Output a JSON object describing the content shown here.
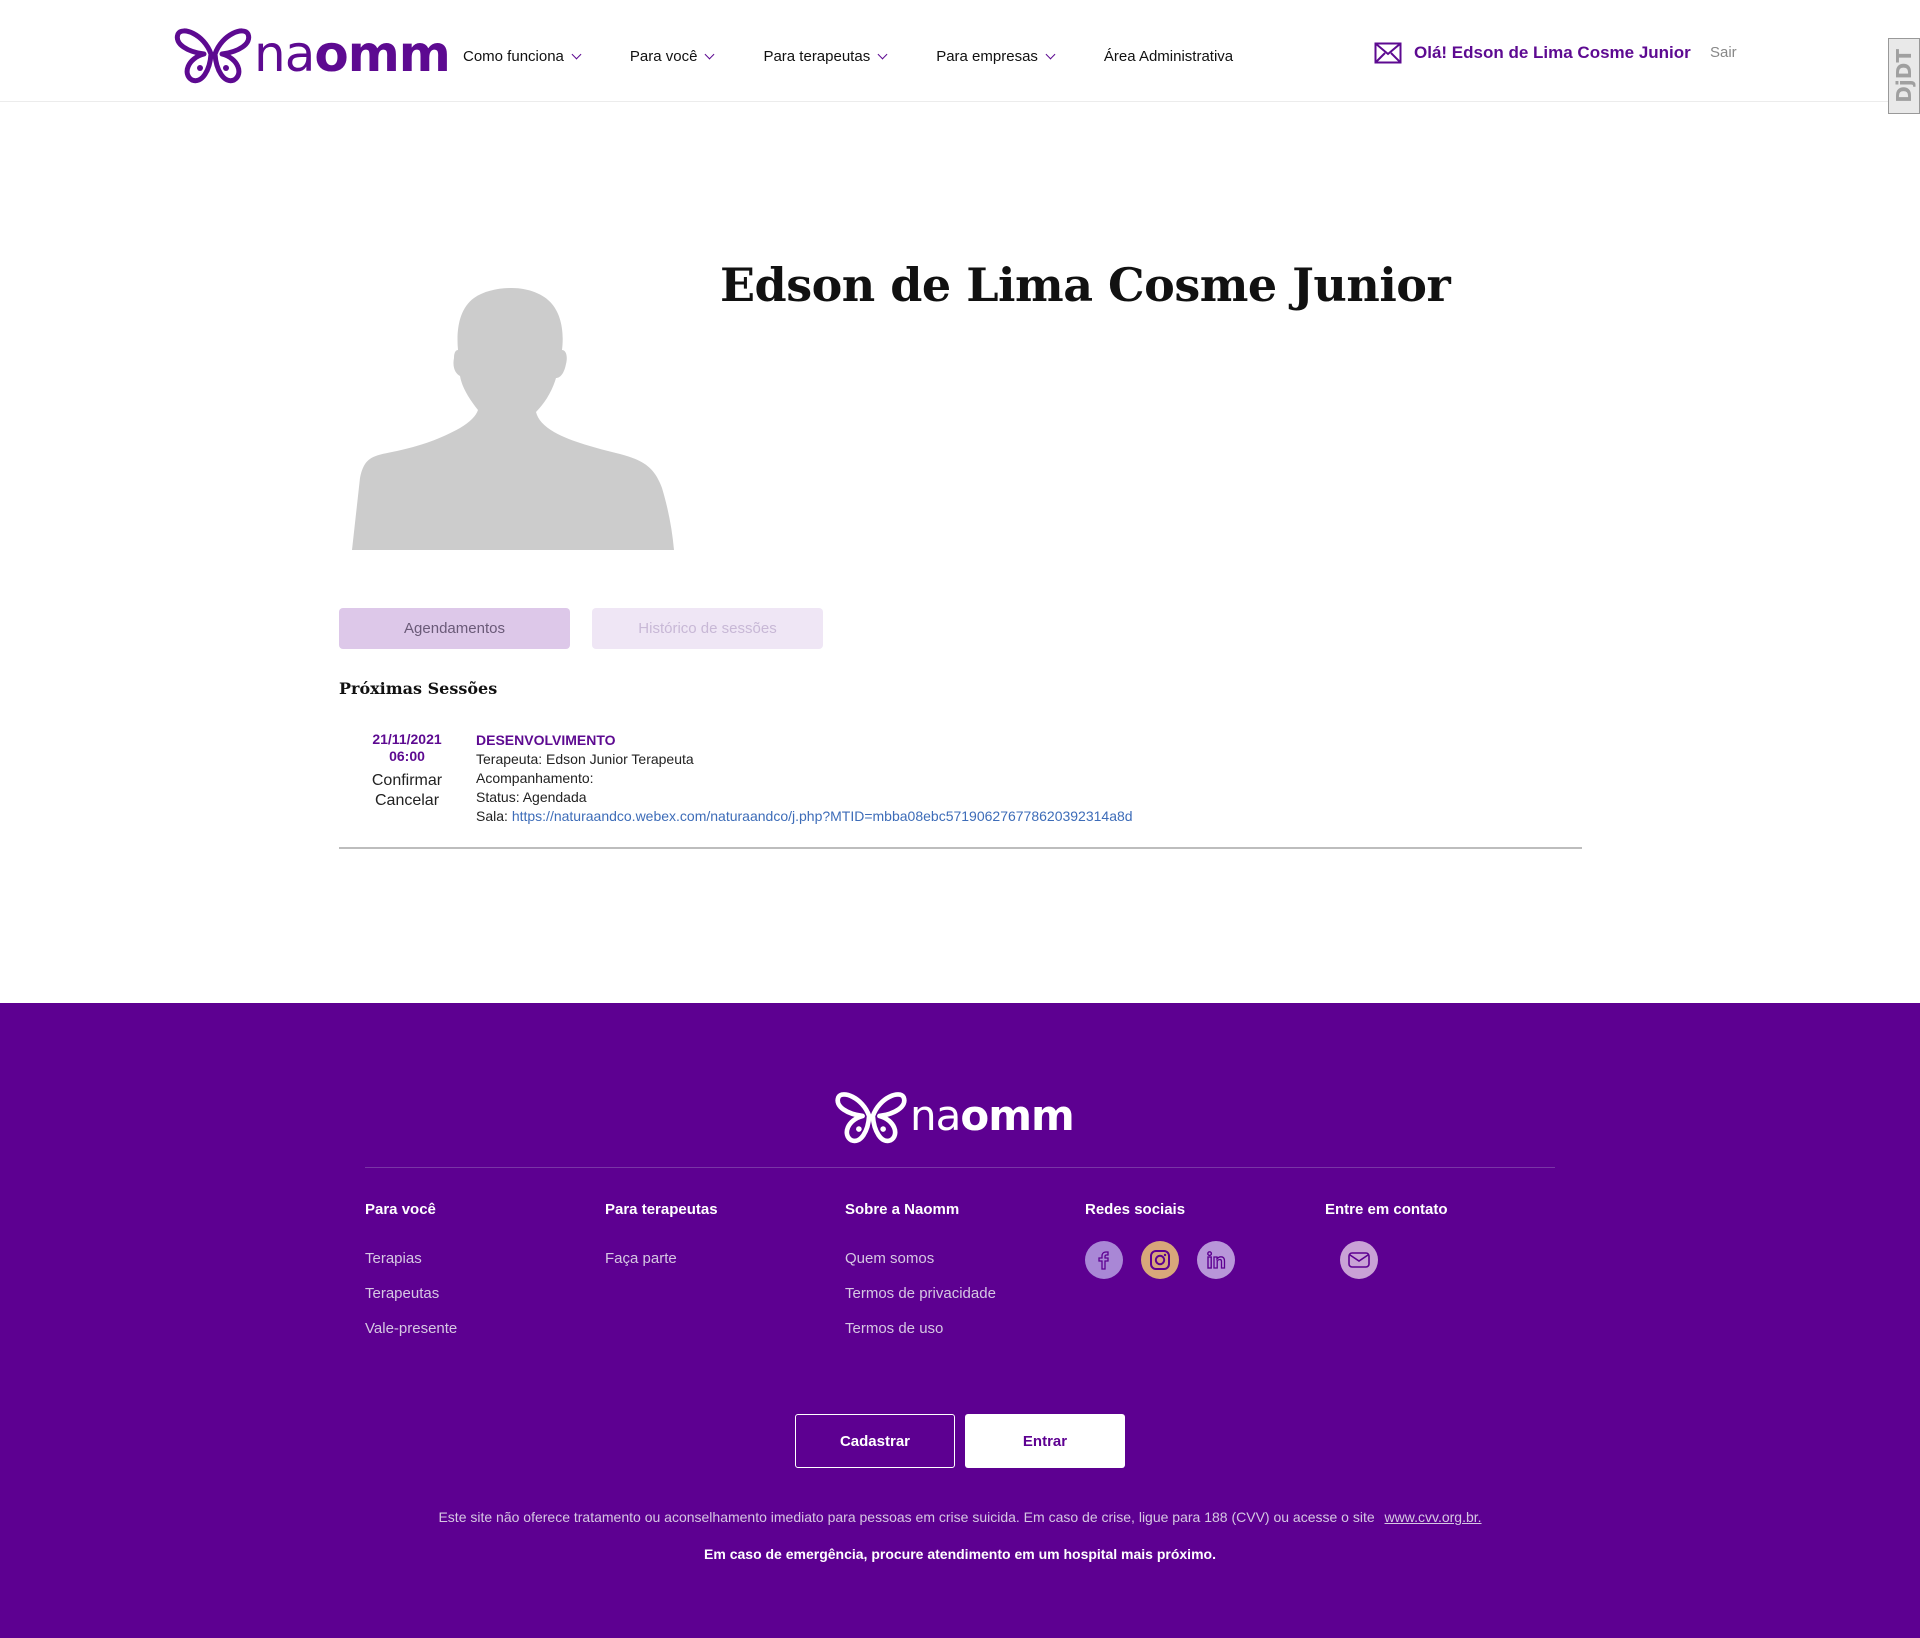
{
  "brand": {
    "logo_text_light": "na",
    "logo_text_bold": "omm",
    "color": "#5d0a91"
  },
  "nav": {
    "items": [
      {
        "label": "Como funciona",
        "has_dropdown": true
      },
      {
        "label": "Para você",
        "has_dropdown": true
      },
      {
        "label": "Para terapeutas",
        "has_dropdown": true
      },
      {
        "label": "Para empresas",
        "has_dropdown": true
      },
      {
        "label": "Área Administrativa",
        "has_dropdown": false
      }
    ],
    "greeting": "Olá! Edson de Lima Cosme Junior",
    "logout": "Sair",
    "side_badge": "DjDT"
  },
  "profile": {
    "name": "Edson de Lima Cosme Junior",
    "tabs": {
      "active": "Agendamentos",
      "inactive": "Histórico de sessões"
    },
    "section_title": "Próximas Sessões",
    "sessions": [
      {
        "date": "21/11/2021",
        "time": "06:00",
        "confirm": "Confirmar",
        "cancel": "Cancelar",
        "type": "DESENVOLVIMENTO",
        "therapist_line": "Terapeuta: Edson Junior Terapeuta",
        "followup_line": "Acompanhamento:",
        "status_line": "Status: Agendada",
        "room_label": "Sala:",
        "room_url": "https://naturaandco.webex.com/naturaandco/j.php?MTID=mbba08ebc5719062767786​20392314a8d"
      }
    ]
  },
  "footer": {
    "bg_color": "#5d0091",
    "columns": {
      "para_voce": {
        "title": "Para você",
        "links": [
          "Terapias",
          "Terapeutas",
          "Vale-presente"
        ]
      },
      "para_terapeutas": {
        "title": "Para terapeutas",
        "links": [
          "Faça parte"
        ]
      },
      "sobre": {
        "title": "Sobre a Naomm",
        "links": [
          "Quem somos",
          "Termos de privacidade",
          "Termos de uso"
        ]
      },
      "redes": {
        "title": "Redes sociais",
        "icons": [
          "facebook-icon",
          "instagram-icon",
          "linkedin-icon"
        ]
      },
      "contato": {
        "title": "Entre em contato",
        "icons": [
          "mail-icon"
        ]
      }
    },
    "buttons": {
      "register": "Cadastrar",
      "login": "Entrar"
    },
    "disclaimer": "Este site não oferece tratamento ou aconselhamento imediato para pessoas em crise suicida. Em caso de crise, ligue para 188 (CVV) ou acesse o site",
    "disclaimer_link": "www.cvv.org.br.",
    "emergency": "Em caso de emergência, procure atendimento em um hospital mais próximo."
  }
}
